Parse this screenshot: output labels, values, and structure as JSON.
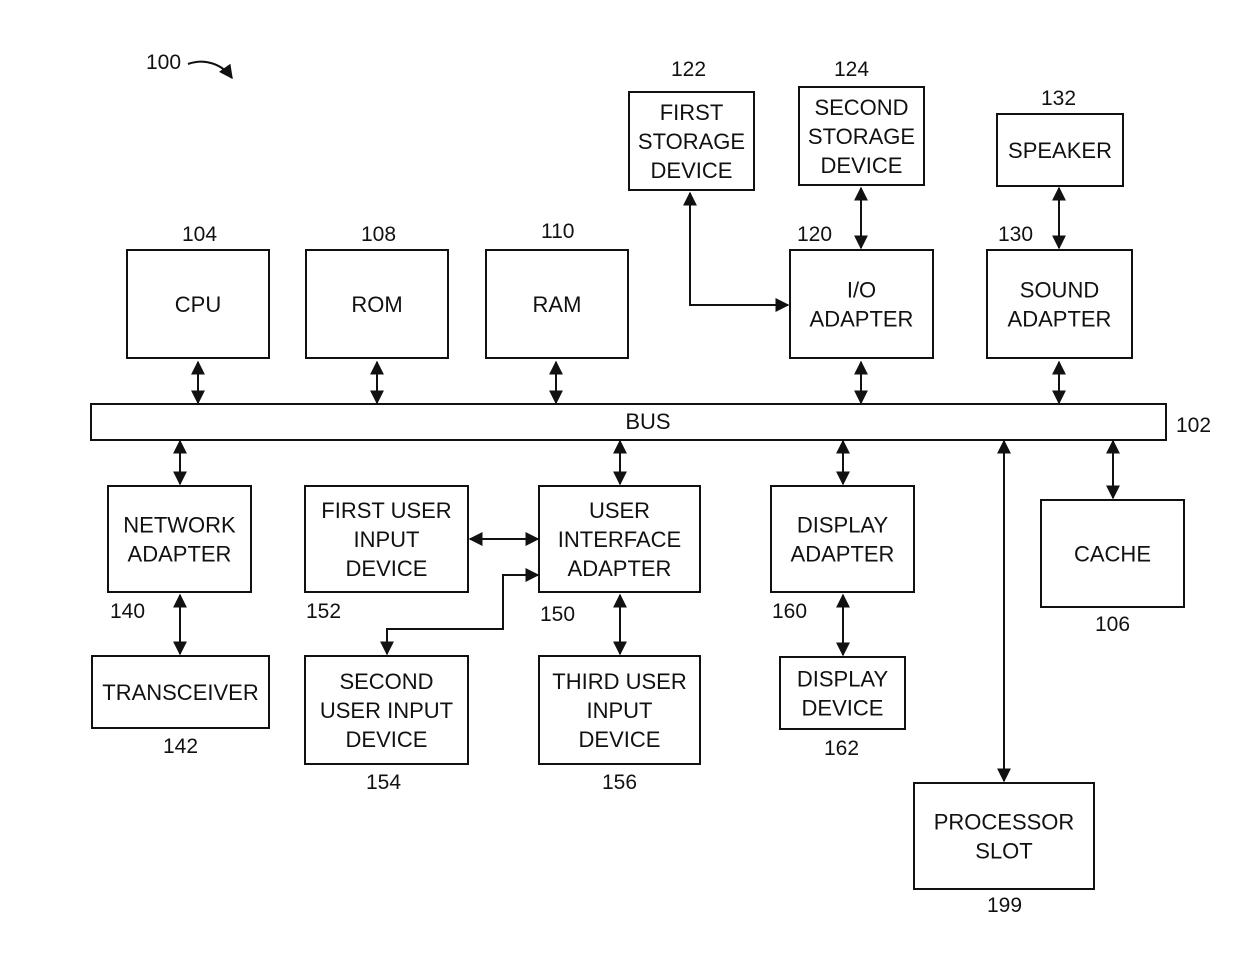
{
  "figure": {
    "ref": "100",
    "bus": {
      "label": "BUS",
      "ref": "102"
    },
    "blocks": [
      {
        "id": "cpu",
        "lines": [
          "CPU"
        ],
        "ref": "104"
      },
      {
        "id": "rom",
        "lines": [
          "ROM"
        ],
        "ref": "108"
      },
      {
        "id": "ram",
        "lines": [
          "RAM"
        ],
        "ref": "110"
      },
      {
        "id": "io_adapter",
        "lines": [
          "I/O",
          "ADAPTER"
        ],
        "ref": "120"
      },
      {
        "id": "first_storage",
        "lines": [
          "FIRST",
          "STORAGE",
          "DEVICE"
        ],
        "ref": "122"
      },
      {
        "id": "second_storage",
        "lines": [
          "SECOND",
          "STORAGE",
          "DEVICE"
        ],
        "ref": "124"
      },
      {
        "id": "sound_adapter",
        "lines": [
          "SOUND",
          "ADAPTER"
        ],
        "ref": "130"
      },
      {
        "id": "speaker",
        "lines": [
          "SPEAKER"
        ],
        "ref": "132"
      },
      {
        "id": "network_adapter",
        "lines": [
          "NETWORK",
          "ADAPTER"
        ],
        "ref": "140"
      },
      {
        "id": "transceiver",
        "lines": [
          "TRANSCEIVER"
        ],
        "ref": "142"
      },
      {
        "id": "first_user_input",
        "lines": [
          "FIRST USER",
          "INPUT",
          "DEVICE"
        ],
        "ref": "152"
      },
      {
        "id": "ui_adapter",
        "lines": [
          "USER",
          "INTERFACE",
          "ADAPTER"
        ],
        "ref": "150"
      },
      {
        "id": "second_user_input",
        "lines": [
          "SECOND",
          "USER INPUT",
          "DEVICE"
        ],
        "ref": "154"
      },
      {
        "id": "third_user_input",
        "lines": [
          "THIRD USER",
          "INPUT",
          "DEVICE"
        ],
        "ref": "156"
      },
      {
        "id": "display_adapter",
        "lines": [
          "DISPLAY",
          "ADAPTER"
        ],
        "ref": "160"
      },
      {
        "id": "display_device",
        "lines": [
          "DISPLAY",
          "DEVICE"
        ],
        "ref": "162"
      },
      {
        "id": "cache",
        "lines": [
          "CACHE"
        ],
        "ref": "106"
      },
      {
        "id": "processor_slot",
        "lines": [
          "PROCESSOR",
          "SLOT"
        ],
        "ref": "199"
      }
    ],
    "connections": [
      {
        "from": "cpu",
        "to": "bus",
        "type": "bidirectional"
      },
      {
        "from": "rom",
        "to": "bus",
        "type": "bidirectional"
      },
      {
        "from": "ram",
        "to": "bus",
        "type": "bidirectional"
      },
      {
        "from": "io_adapter",
        "to": "bus",
        "type": "bidirectional"
      },
      {
        "from": "sound_adapter",
        "to": "bus",
        "type": "bidirectional"
      },
      {
        "from": "first_storage",
        "to": "io_adapter",
        "type": "bidirectional"
      },
      {
        "from": "second_storage",
        "to": "io_adapter",
        "type": "bidirectional"
      },
      {
        "from": "speaker",
        "to": "sound_adapter",
        "type": "bidirectional"
      },
      {
        "from": "bus",
        "to": "network_adapter",
        "type": "bidirectional"
      },
      {
        "from": "network_adapter",
        "to": "transceiver",
        "type": "bidirectional"
      },
      {
        "from": "bus",
        "to": "ui_adapter",
        "type": "bidirectional"
      },
      {
        "from": "first_user_input",
        "to": "ui_adapter",
        "type": "bidirectional"
      },
      {
        "from": "ui_adapter",
        "to": "second_user_input",
        "type": "bidirectional"
      },
      {
        "from": "ui_adapter",
        "to": "third_user_input",
        "type": "bidirectional"
      },
      {
        "from": "bus",
        "to": "display_adapter",
        "type": "bidirectional"
      },
      {
        "from": "display_adapter",
        "to": "display_device",
        "type": "bidirectional"
      },
      {
        "from": "bus",
        "to": "cache",
        "type": "bidirectional"
      },
      {
        "from": "bus",
        "to": "processor_slot",
        "type": "bidirectional"
      }
    ]
  }
}
